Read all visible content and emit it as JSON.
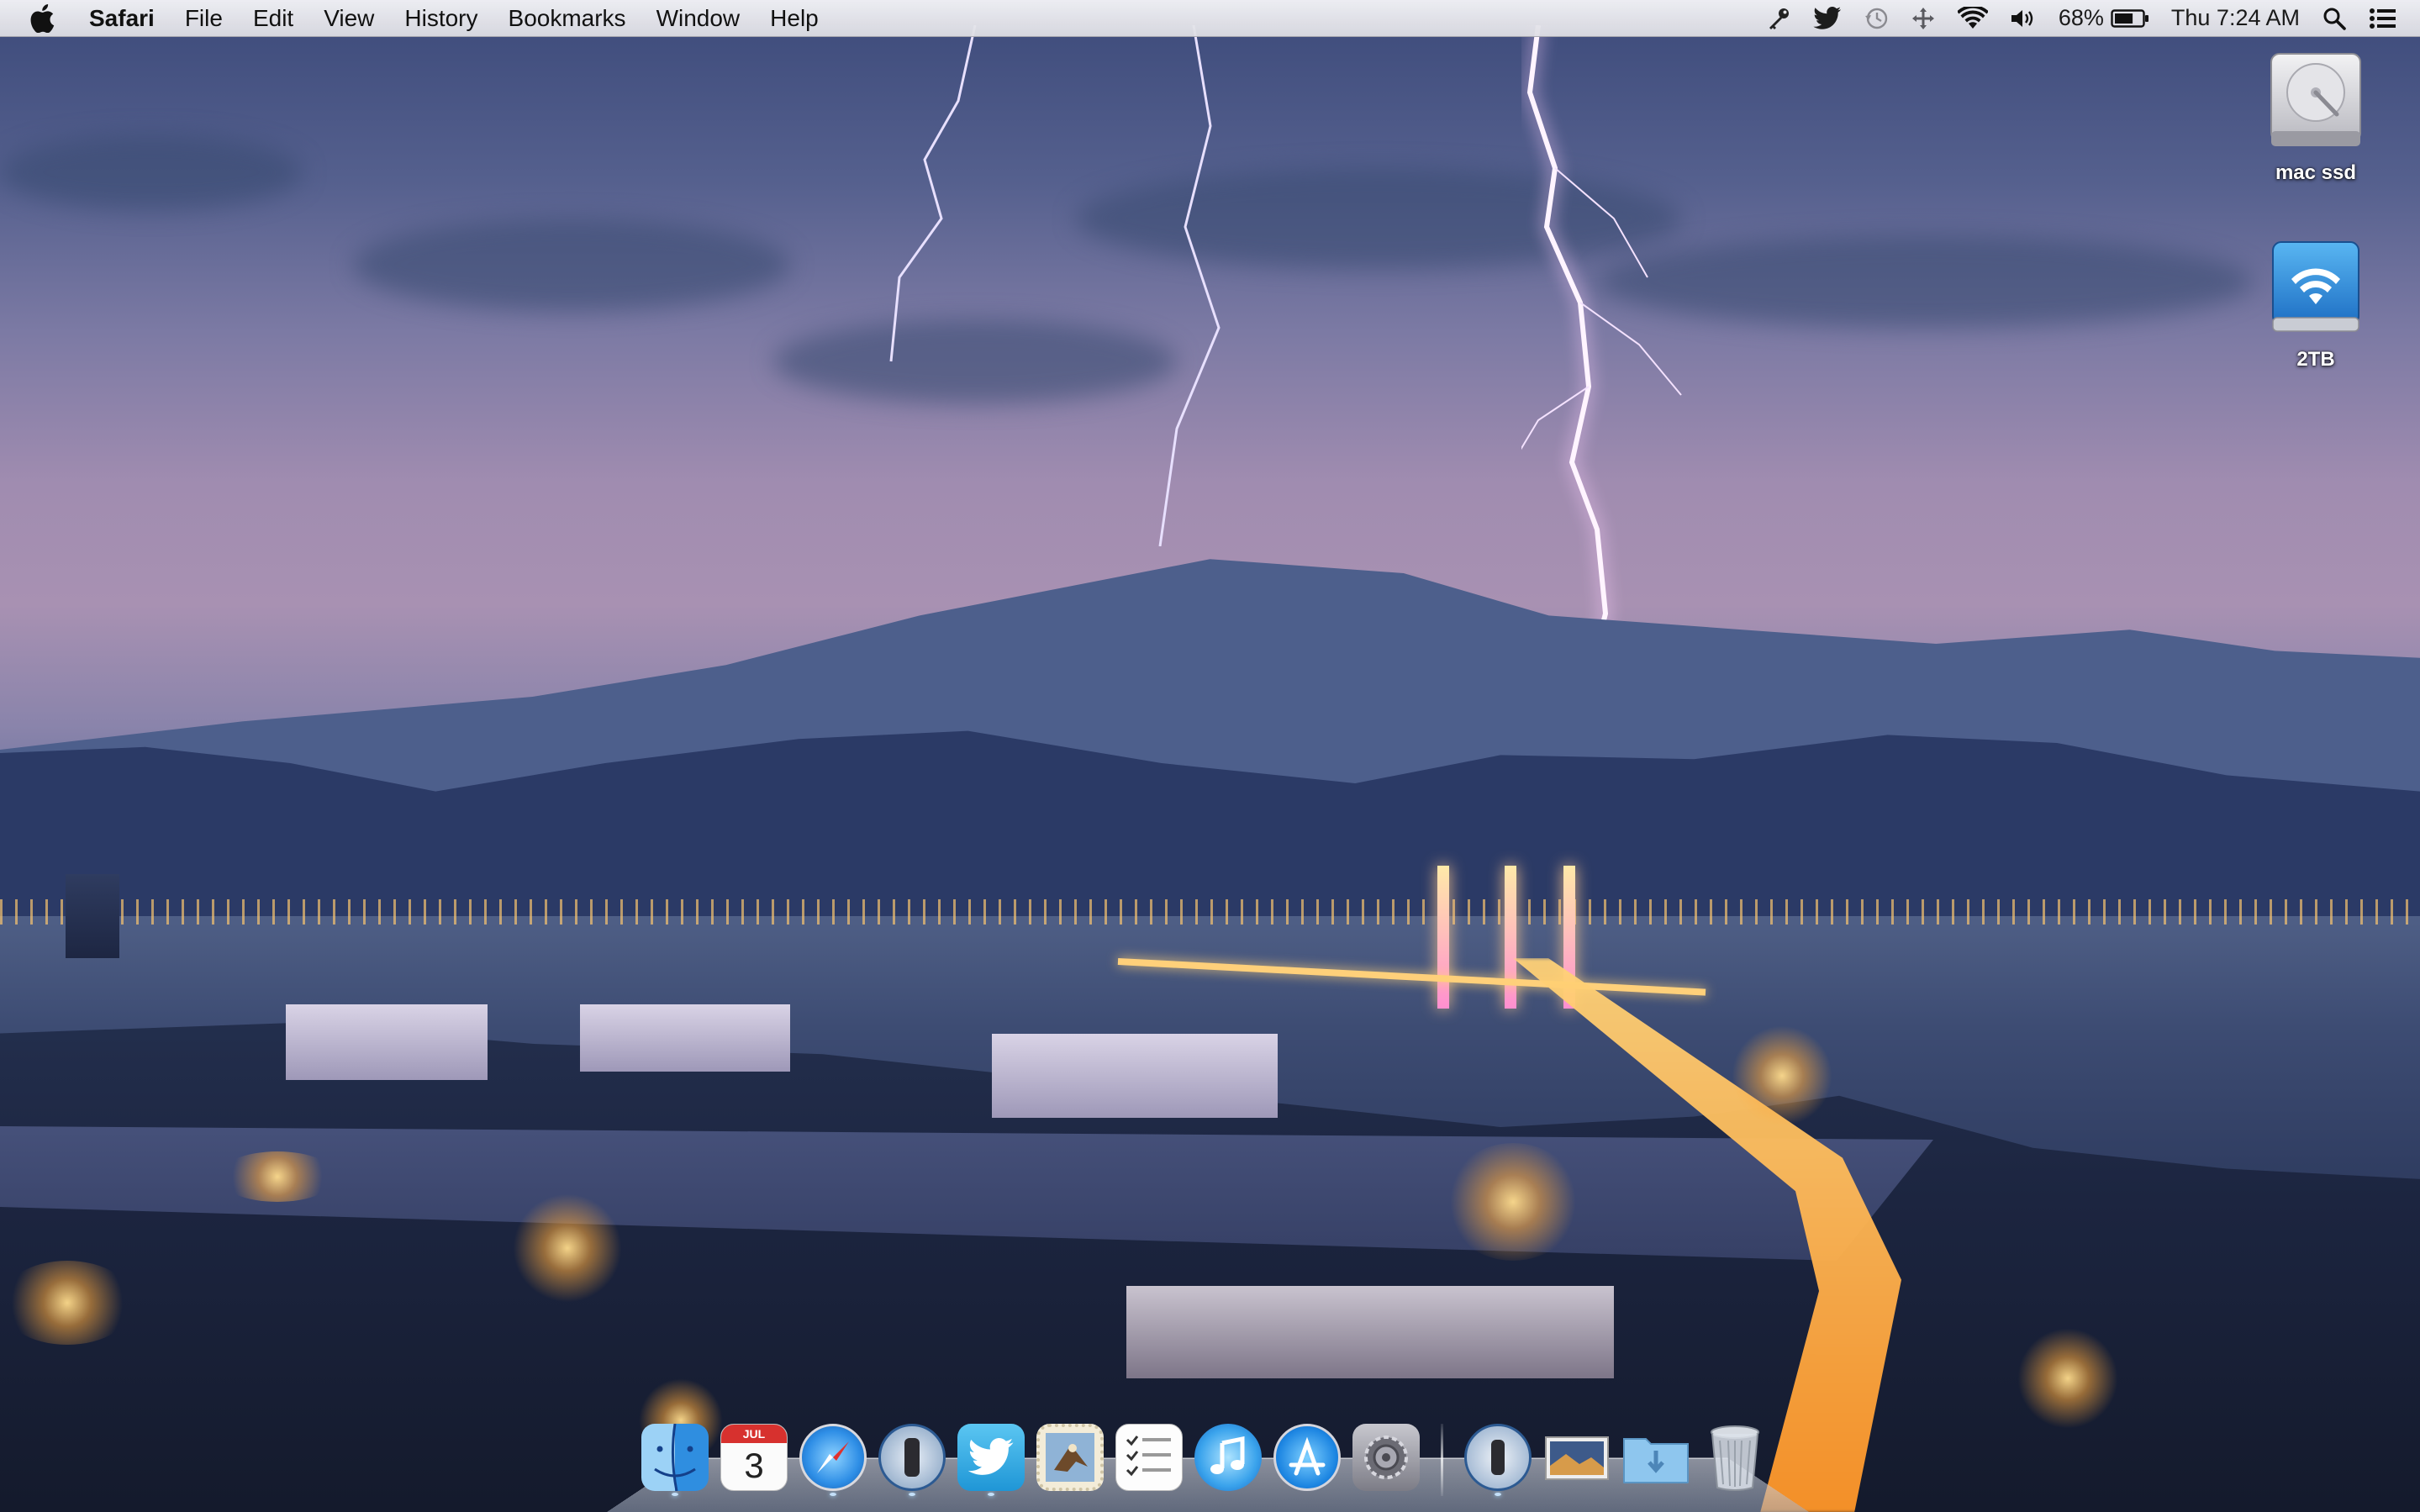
{
  "menubar": {
    "apple_icon": "apple-icon",
    "app_name": "Safari",
    "menus": [
      "File",
      "Edit",
      "View",
      "History",
      "Bookmarks",
      "Window",
      "Help"
    ],
    "status": {
      "battery_percent": "68%",
      "clock": "Thu 7:24 AM"
    }
  },
  "desktop_icons": [
    {
      "label": "mac ssd",
      "icon": "hard-drive-icon"
    },
    {
      "label": "2TB",
      "icon": "network-drive-icon"
    }
  ],
  "dock": {
    "items": [
      {
        "name": "finder",
        "icon": "finder-icon",
        "running": true
      },
      {
        "name": "calendar",
        "icon": "calendar-icon",
        "running": false,
        "calendar_month": "JUL",
        "calendar_day": "3"
      },
      {
        "name": "safari",
        "icon": "safari-icon",
        "running": true
      },
      {
        "name": "1password",
        "icon": "1password-icon",
        "running": true
      },
      {
        "name": "twitter",
        "icon": "twitter-icon",
        "running": true
      },
      {
        "name": "mail-stamp",
        "icon": "mail-stamp-icon",
        "running": false
      },
      {
        "name": "reminders",
        "icon": "reminders-icon",
        "running": false
      },
      {
        "name": "itunes",
        "icon": "itunes-icon",
        "running": false
      },
      {
        "name": "app-store",
        "icon": "app-store-icon",
        "running": false
      },
      {
        "name": "system-preferences",
        "icon": "system-preferences-icon",
        "running": false
      },
      {
        "name": "1password-mini",
        "icon": "1password-mini-icon",
        "running": true
      },
      {
        "name": "desktop-folder",
        "icon": "photo-folder-icon",
        "running": false
      },
      {
        "name": "downloads-folder",
        "icon": "downloads-folder-icon",
        "running": false
      },
      {
        "name": "trash",
        "icon": "trash-icon",
        "running": false
      }
    ]
  },
  "colors": {
    "menubar_bg": "#efeff3",
    "dock_dot": "#c8e6ff",
    "twitter_blue": "#2aa9e0"
  }
}
